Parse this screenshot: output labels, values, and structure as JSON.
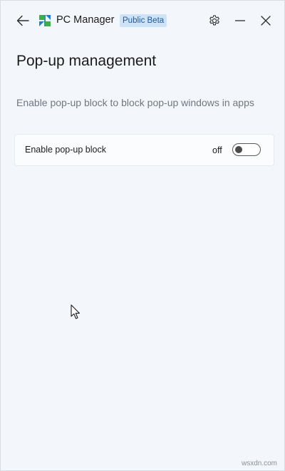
{
  "header": {
    "app_title": "PC Manager",
    "badge": "Public Beta",
    "icons": {
      "back": "arrow-left-icon",
      "logo": "pc-manager-logo",
      "settings": "gear-icon",
      "minimize": "minimize-icon",
      "close": "close-icon"
    }
  },
  "page": {
    "title": "Pop-up management",
    "description": "Enable pop-up block to block pop-up windows in apps"
  },
  "setting": {
    "label": "Enable pop-up block",
    "state": "off",
    "enabled": false
  },
  "watermark": "wsxdn.com",
  "colors": {
    "background": "#f3f7fb",
    "badge_bg": "#cfe3f8",
    "badge_text": "#1f5a9a",
    "logo_green": "#3fae49",
    "logo_blue": "#1f7fd6"
  }
}
